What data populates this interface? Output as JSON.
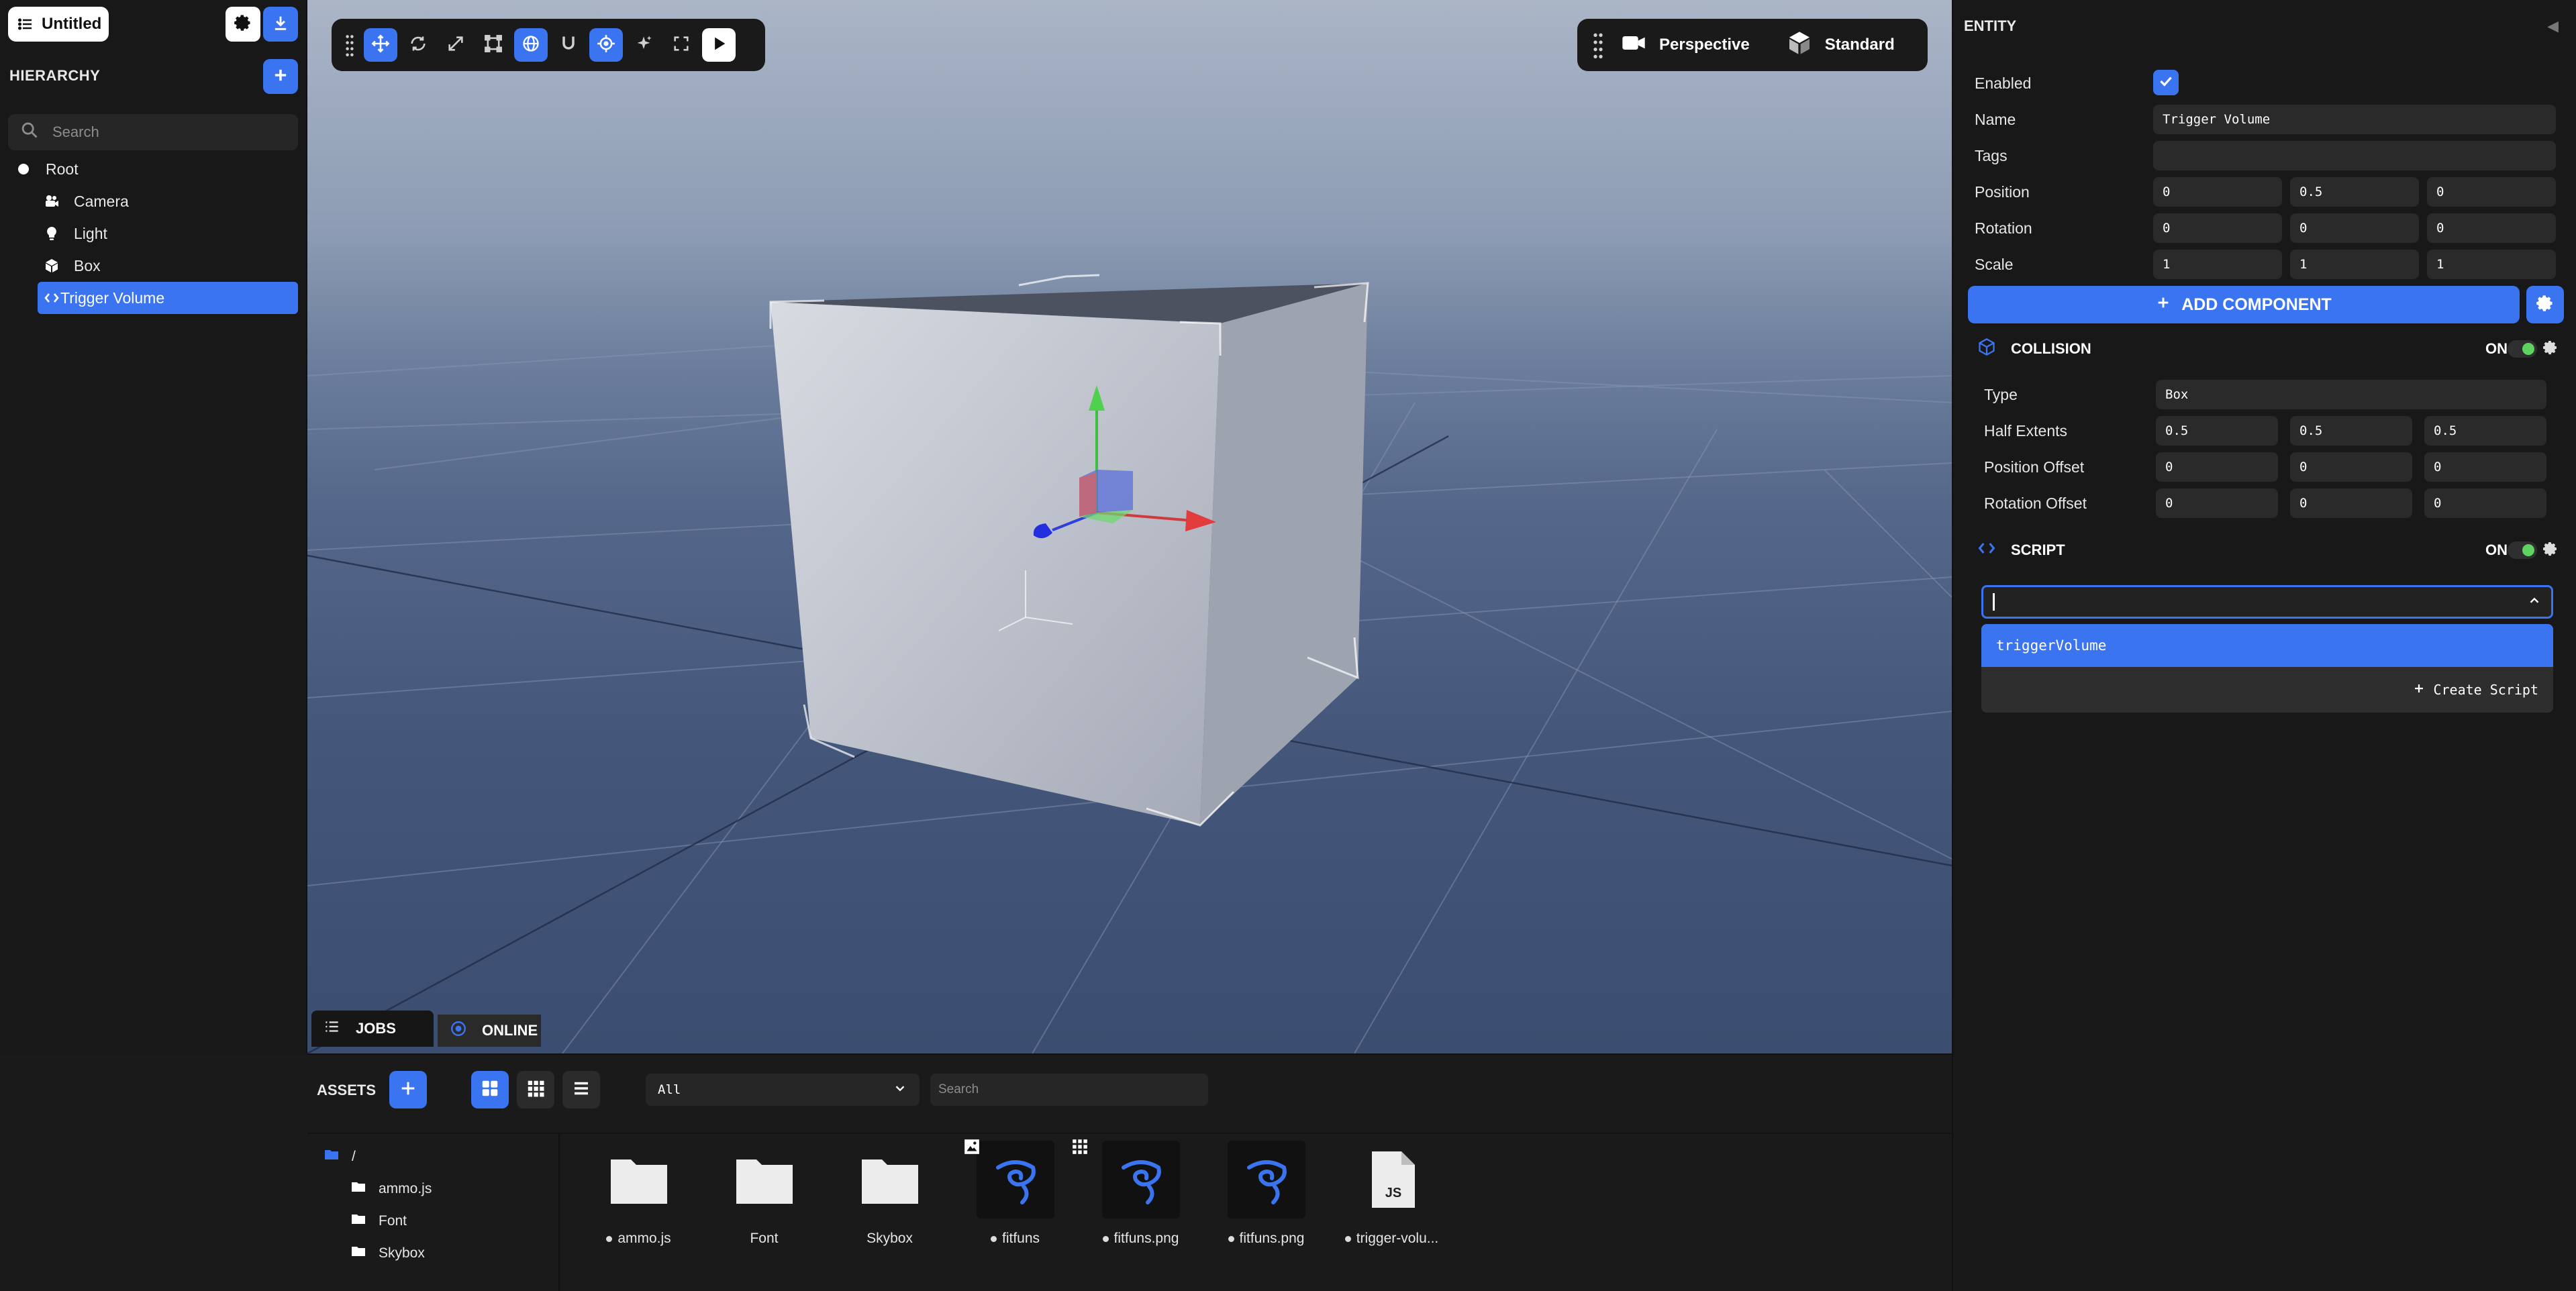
{
  "project": {
    "title": "Untitled"
  },
  "hierarchy": {
    "title": "HIERARCHY",
    "search_placeholder": "Search",
    "items": [
      {
        "label": "Root",
        "icon": "root-dot-icon"
      },
      {
        "label": "Camera",
        "icon": "camera-icon"
      },
      {
        "label": "Light",
        "icon": "light-bulb-icon"
      },
      {
        "label": "Box",
        "icon": "box-icon"
      },
      {
        "label": "Trigger Volume",
        "icon": "script-icon",
        "selected": true
      }
    ]
  },
  "viewport": {
    "camera_mode": "Perspective",
    "render_mode": "Standard",
    "tabs": {
      "jobs": "JOBS",
      "online": "ONLINE"
    }
  },
  "inspector": {
    "title": "ENTITY",
    "enabled_label": "Enabled",
    "name_label": "Name",
    "name_value": "Trigger Volume",
    "tags_label": "Tags",
    "tags_value": "",
    "position_label": "Position",
    "position": [
      "0",
      "0.5",
      "0"
    ],
    "rotation_label": "Rotation",
    "rotation": [
      "0",
      "0",
      "0"
    ],
    "scale_label": "Scale",
    "scale": [
      "1",
      "1",
      "1"
    ],
    "add_component": "ADD COMPONENT",
    "collision": {
      "title": "COLLISION",
      "state": "ON",
      "type_label": "Type",
      "type_value": "Box",
      "half_extents_label": "Half Extents",
      "half_extents": [
        "0.5",
        "0.5",
        "0.5"
      ],
      "position_offset_label": "Position Offset",
      "position_offset": [
        "0",
        "0",
        "0"
      ],
      "rotation_offset_label": "Rotation Offset",
      "rotation_offset": [
        "0",
        "0",
        "0"
      ]
    },
    "script": {
      "title": "SCRIPT",
      "state": "ON",
      "input_value": "",
      "option": "triggerVolume",
      "create_label": "Create Script"
    }
  },
  "assets": {
    "title": "ASSETS",
    "filter": "All",
    "search_placeholder": "Search",
    "tree": [
      {
        "label": "/"
      },
      {
        "label": "ammo.js"
      },
      {
        "label": "Font"
      },
      {
        "label": "Skybox"
      }
    ],
    "items": [
      {
        "label": "ammo.js",
        "kind": "folder",
        "dot": true
      },
      {
        "label": "Font",
        "kind": "folder",
        "dot": false
      },
      {
        "label": "Skybox",
        "kind": "folder",
        "dot": false
      },
      {
        "label": "fitfuns",
        "kind": "image",
        "dot": true,
        "badge": "image-badge-icon"
      },
      {
        "label": "fitfuns.png",
        "kind": "image",
        "dot": true,
        "badge": "atlas-badge-icon"
      },
      {
        "label": "fitfuns.png",
        "kind": "image",
        "dot": true
      },
      {
        "label": "trigger-volu...",
        "kind": "script",
        "dot": true,
        "file_glyph": "JS"
      }
    ]
  },
  "colors": {
    "accent": "#3b74f0",
    "panel": "#181818",
    "toggle_on": "#5fd35f"
  }
}
